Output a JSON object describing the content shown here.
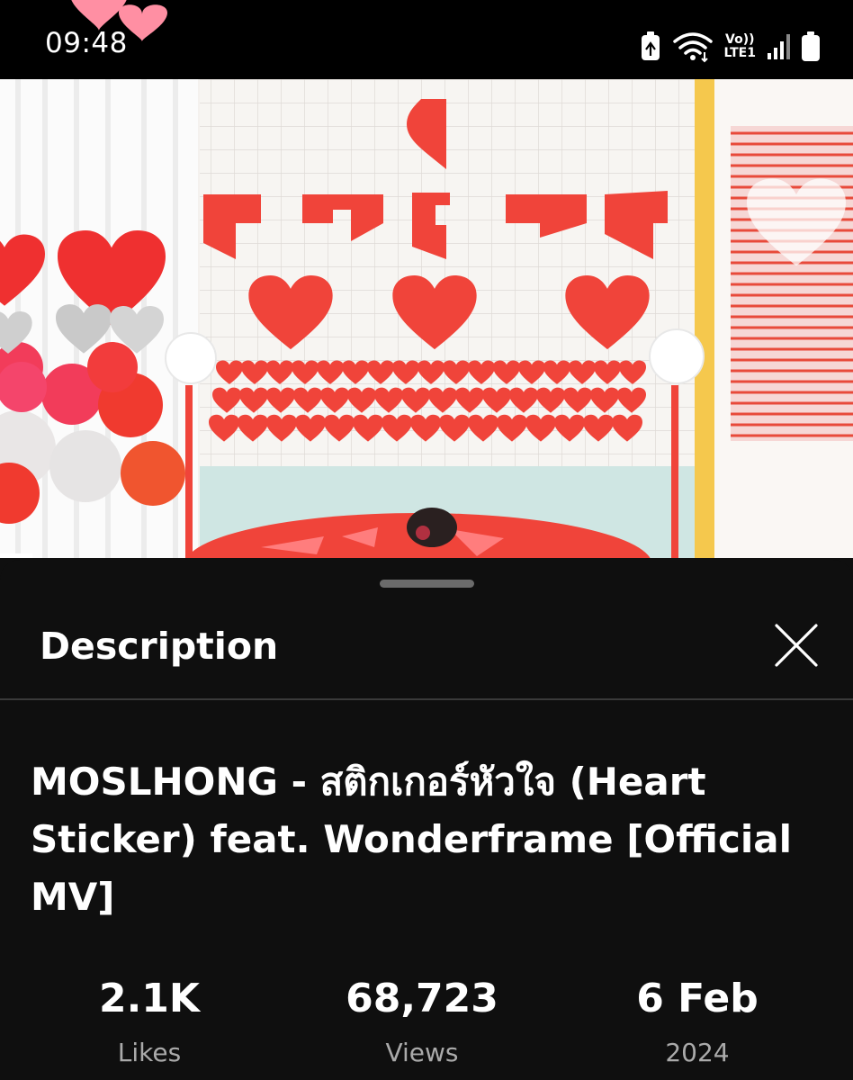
{
  "status_bar": {
    "time": "09:48",
    "icons": [
      "heart-decoration-icon",
      "battery-saver-icon",
      "wifi-icon",
      "volte-icon",
      "signal-icon",
      "battery-icon"
    ],
    "volte_top": "Vo))",
    "volte_bottom": "LTE1"
  },
  "video": {
    "thumbnail_icon": "video-frame-hearts"
  },
  "description_panel": {
    "title": "Description",
    "close_icon": "close-icon",
    "video_title": "MOSLHONG - สติกเกอร์หัวใจ (Heart Sticker) feat. Wonderframe [Official MV]",
    "stats": [
      {
        "value": "2.1K",
        "label": "Likes"
      },
      {
        "value": "68,723",
        "label": "Views"
      },
      {
        "value": "6 Feb",
        "label": "2024"
      }
    ]
  },
  "colors": {
    "sheet_background": "#0f0f0f",
    "status_background": "#000000",
    "divider": "#3a3a3a",
    "secondary_text": "#aaaaaa",
    "heart_red": "#f03e3e"
  }
}
